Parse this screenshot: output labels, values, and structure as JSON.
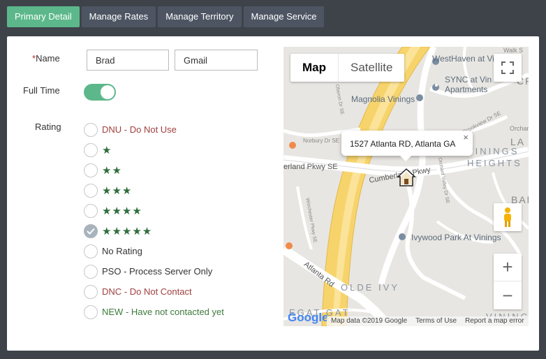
{
  "tabs": [
    {
      "label": "Primary Detail",
      "active": true
    },
    {
      "label": "Manage Rates",
      "active": false
    },
    {
      "label": "Manage Territory",
      "active": false
    },
    {
      "label": "Manage Service",
      "active": false
    }
  ],
  "form": {
    "name_required": "*",
    "name_label": "Name",
    "first_name": "Brad",
    "last_name": "Gmail",
    "fulltime_label": "Full Time",
    "fulltime_on": true,
    "rating_label": "Rating",
    "rating_options": [
      {
        "text": "DNU - Do Not Use",
        "color": "#a04040",
        "stars": 0,
        "checked": false
      },
      {
        "text": "★",
        "color": "#2f6e3c",
        "stars": 1,
        "checked": false
      },
      {
        "text": "★★",
        "color": "#2f6e3c",
        "stars": 2,
        "checked": false
      },
      {
        "text": "★★★",
        "color": "#2f6e3c",
        "stars": 3,
        "checked": false
      },
      {
        "text": "★★★★",
        "color": "#2f6e3c",
        "stars": 4,
        "checked": false
      },
      {
        "text": "★★★★★",
        "color": "#2f6e3c",
        "stars": 5,
        "checked": true
      },
      {
        "text": "No Rating",
        "color": "#333333",
        "stars": 0,
        "checked": false
      },
      {
        "text": "PSO - Process Server Only",
        "color": "#333333",
        "stars": 0,
        "checked": false
      },
      {
        "text": "DNC - Do Not Contact",
        "color": "#a04040",
        "stars": 0,
        "checked": false
      },
      {
        "text": "NEW - Have not contacted yet",
        "color": "#3d7a3d",
        "stars": 0,
        "checked": false
      }
    ]
  },
  "map": {
    "map_btn": "Map",
    "satellite_btn": "Satellite",
    "infowindow_text": "1527 Atlanta RD, Atlanta GA",
    "infowindow_close": "×",
    "zoom_in": "+",
    "zoom_out": "−",
    "labels": {
      "westhaven": "WestHaven at Vinings",
      "sync": "SYNC at Vin",
      "apartments": "Apartments",
      "magnolia": "Magnolia Vinings",
      "vinings_heights_1": "VININGS",
      "vinings_heights_2": "HEIGHTS",
      "cumberland": "Cumberland Pkwy",
      "erland": "erland Pkwy SE",
      "ivywood": "Ivywood Park At Vinings",
      "olde_ivy": "OLDE IVY",
      "atlanta_rd": "Atlanta Rd",
      "norbury": "Norbury Dr SE",
      "orchard": "Orchard",
      "walk": "Walk S",
      "brookview": "Brookview Dr SE",
      "la": "LA",
      "cr": "CR",
      "bak": "BAK",
      "vinings_bottom": "VININGS",
      "winchester": "Winchester Pkwy SE",
      "orchard_valley": "Orchard Valley Dr SE",
      "oberon": "Oberon Dr SE",
      "g_catg": "EGAT GAT"
    },
    "attribution": {
      "data": "Map data ©2019 Google",
      "terms": "Terms of Use",
      "report": "Report a map error"
    },
    "logo": "Google"
  }
}
